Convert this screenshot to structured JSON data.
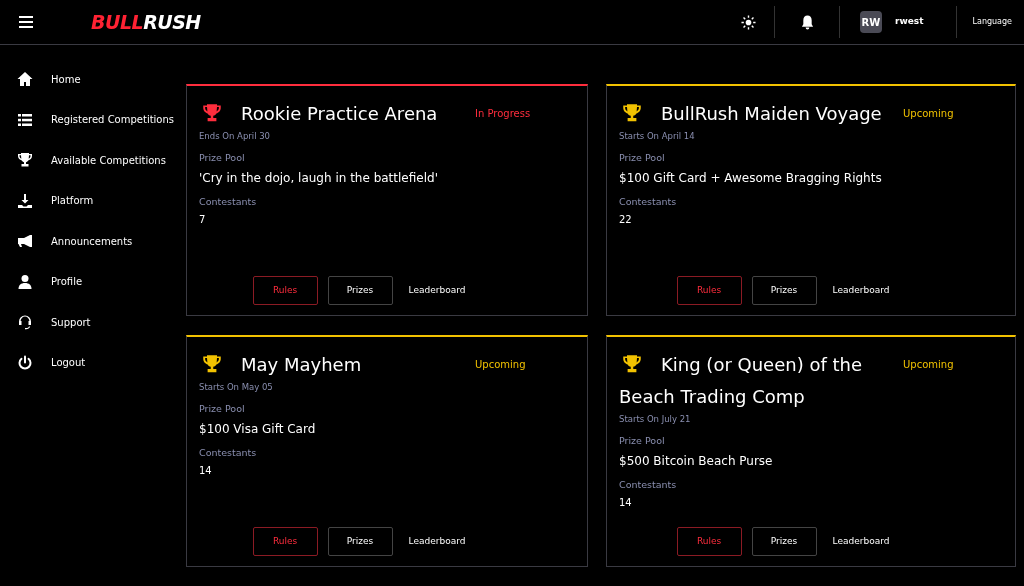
{
  "topbar": {
    "logo": {
      "accent": "BULL",
      "rest": "RUSH"
    },
    "avatar": "RW",
    "username": "rwest",
    "language": "Language"
  },
  "sidebar": {
    "items": [
      {
        "label": "Home"
      },
      {
        "label": "Registered Competitions"
      },
      {
        "label": "Available Competitions"
      },
      {
        "label": "Platform"
      },
      {
        "label": "Announcements"
      },
      {
        "label": "Profile"
      },
      {
        "label": "Support"
      },
      {
        "label": "Logout"
      }
    ]
  },
  "competitions": [
    {
      "title": "Rookie Practice Arena",
      "status": "In Progress",
      "kind": "in_progress",
      "date": "Ends On April 30",
      "prize_label": "Prize Pool",
      "prize": "'Cry in the dojo, laugh in the battlefield'",
      "contestants_label": "Contestants",
      "contestants": "7",
      "buttons": [
        "Rules",
        "Prizes",
        "Leaderboard"
      ]
    },
    {
      "title": "BullRush Maiden Voyage",
      "status": "Upcoming",
      "kind": "upcoming",
      "date": "Starts On April 14",
      "prize_label": "Prize Pool",
      "prize": "$100 Gift Card + Awesome Bragging Rights",
      "contestants_label": "Contestants",
      "contestants": "22",
      "buttons": [
        "Rules",
        "Prizes",
        "Leaderboard"
      ]
    },
    {
      "title": "May Mayhem",
      "status": "Upcoming",
      "kind": "upcoming",
      "date": "Starts On May 05",
      "prize_label": "Prize Pool",
      "prize": "$100 Visa Gift Card",
      "contestants_label": "Contestants",
      "contestants": "14",
      "buttons": [
        "Rules",
        "Prizes",
        "Leaderboard"
      ]
    },
    {
      "title": "King (or Queen) of the Beach Trading Comp",
      "status": "Upcoming",
      "kind": "upcoming",
      "date": "Starts On July 21",
      "prize_label": "Prize Pool",
      "prize": "$500 Bitcoin Beach Purse",
      "contestants_label": "Contestants",
      "contestants": "14",
      "buttons": [
        "Rules",
        "Prizes",
        "Leaderboard"
      ]
    }
  ]
}
